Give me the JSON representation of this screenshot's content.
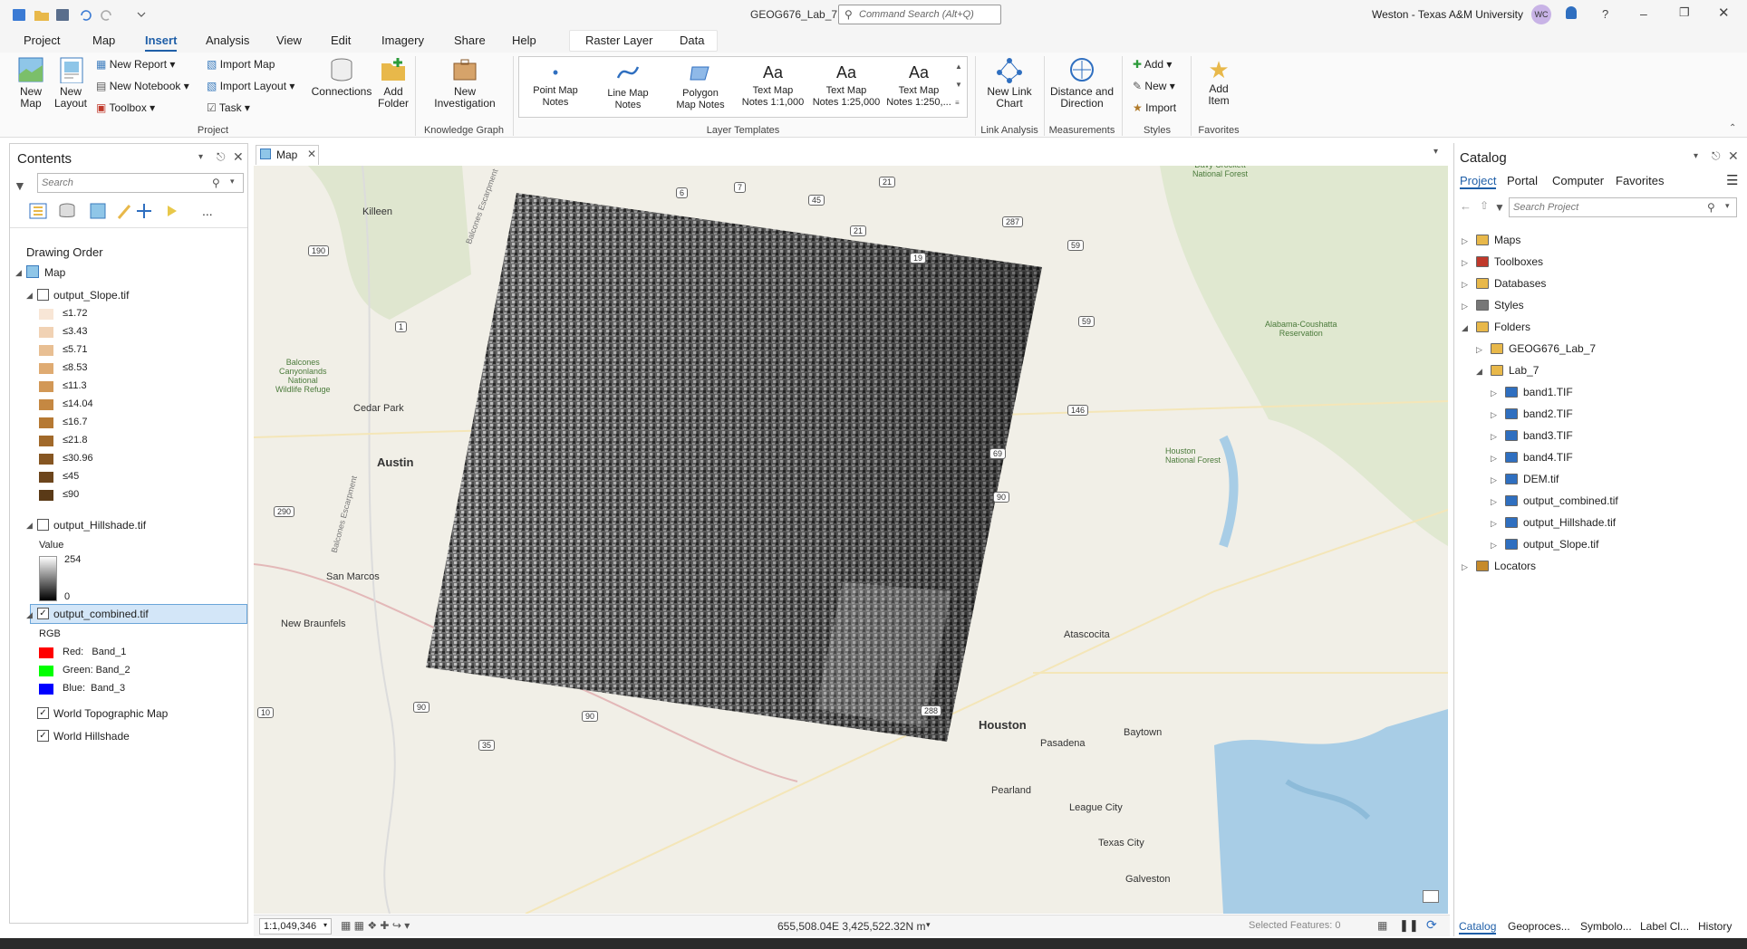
{
  "window": {
    "title": "GEOG676_Lab_7",
    "command_search_placeholder": "Command Search (Alt+Q)",
    "user": "Weston - Texas A&M University",
    "avatar": "WC",
    "help": "?"
  },
  "tabs": [
    {
      "label": "Project"
    },
    {
      "label": "Map"
    },
    {
      "label": "Insert"
    },
    {
      "label": "Analysis"
    },
    {
      "label": "View"
    },
    {
      "label": "Edit"
    },
    {
      "label": "Imagery"
    },
    {
      "label": "Share"
    },
    {
      "label": "Help"
    },
    {
      "label": "Raster Layer"
    },
    {
      "label": "Data"
    }
  ],
  "ribbon": {
    "new_map": "New\nMap",
    "new_layout": "New\nLayout",
    "new_report": "New Report",
    "new_notebook": "New Notebook",
    "toolbox": "Toolbox",
    "import_map": "Import Map",
    "import_layout": "Import Layout",
    "task": "Task",
    "connections": "Connections",
    "add_folder": "Add\nFolder",
    "new_investigation": "New\nInvestigation",
    "templates": [
      "Point Map\nNotes",
      "Line Map\nNotes",
      "Polygon\nMap Notes",
      "Text Map\nNotes 1:1,000",
      "Text Map\nNotes 1:25,000",
      "Text Map\nNotes 1:250,..."
    ],
    "aa": "Aa",
    "new_link_chart": "New Link\nChart",
    "distance_direction": "Distance and\nDirection",
    "add": "Add",
    "new": "New",
    "import": "Import",
    "add_item": "Add\nItem",
    "groups": {
      "project": "Project",
      "knowledge": "Knowledge Graph",
      "layer_templates": "Layer Templates",
      "link_analysis": "Link Analysis",
      "measurements": "Measurements",
      "styles": "Styles",
      "favorites": "Favorites"
    }
  },
  "contents": {
    "title": "Contents",
    "search_placeholder": "Search",
    "more": "...",
    "drawing_order": "Drawing Order",
    "map": "Map",
    "slope": {
      "name": "output_Slope.tif",
      "classes": [
        "≤1.72",
        "≤3.43",
        "≤5.71",
        "≤8.53",
        "≤11.3",
        "≤14.04",
        "≤16.7",
        "≤21.8",
        "≤30.96",
        "≤45",
        "≤90"
      ],
      "colors": [
        "#f8e6d6",
        "#f1d2b4",
        "#e8bf93",
        "#dfab72",
        "#d29856",
        "#c58842",
        "#b67933",
        "#a1692a",
        "#865622",
        "#6c451c",
        "#5a3a17"
      ]
    },
    "hillshade": {
      "name": "output_Hillshade.tif",
      "value_label": "Value",
      "max": "254",
      "min": "0"
    },
    "combined": {
      "name": "output_combined.tif",
      "rgb": "RGB",
      "red": "Red:   Band_1",
      "green": "Green: Band_2",
      "blue": "Blue:  Band_3"
    },
    "topo": "World Topographic Map",
    "hillshade_base": "World Hillshade"
  },
  "map": {
    "tab": "Map"
  },
  "map_labels": {
    "killeen": "Killeen",
    "cedar_park": "Cedar Park",
    "austin": "Austin",
    "san_marcos": "San Marcos",
    "new_braunfels": "New Braunfels",
    "balcones1": "Balcones\nCanyonlands\nNational\nWildlife Refuge",
    "houston": "Houston",
    "pasadena": "Pasadena",
    "baytown": "Baytown",
    "league_city": "League City",
    "texas_city": "Texas City",
    "galveston": "Galveston",
    "pearland": "Pearland",
    "atascocita": "Atascocita",
    "alabama": "Alabama-Coushatta\nReservation",
    "davy": "Davy Crockett\nNational Forest",
    "sam_houston": "Houston\nNational Forest",
    "escarpment": "Balcones Escarpment",
    "shields": [
      "6",
      "7",
      "45",
      "21",
      "287",
      "59",
      "19",
      "190",
      "59",
      "1",
      "146",
      "69",
      "90",
      "290",
      "10",
      "90",
      "90",
      "288",
      "35",
      "21"
    ]
  },
  "status": {
    "scale": "1:1,049,346",
    "coords": "655,508.04E 3,425,522.32N m",
    "selected": "Selected Features: 0"
  },
  "catalog": {
    "title": "Catalog",
    "tabs": [
      "Project",
      "Portal",
      "Computer",
      "Favorites"
    ],
    "search_placeholder": "Search Project",
    "items": [
      "Maps",
      "Toolboxes",
      "Databases",
      "Styles",
      "Folders",
      "GEOG676_Lab_7",
      "Lab_7",
      "band1.TIF",
      "band2.TIF",
      "band3.TIF",
      "band4.TIF",
      "DEM.tif",
      "output_combined.tif",
      "output_Hillshade.tif",
      "output_Slope.tif",
      "Locators"
    ],
    "bottom_tabs": [
      "Catalog",
      "Geoproces...",
      "Symbolo...",
      "Label Cl...",
      "History"
    ]
  }
}
